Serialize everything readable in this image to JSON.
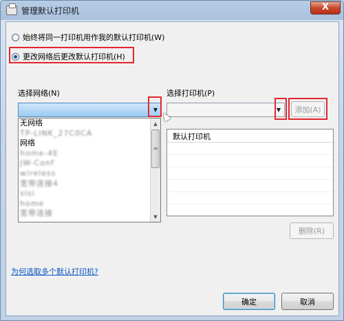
{
  "window": {
    "title": "管理默认打印机",
    "close_glyph": "X"
  },
  "options": {
    "always_same": "始终将同一打印机用作我的默认打印机(W)",
    "change_with_network": "更改网络后更改默认打印机(H)"
  },
  "network": {
    "label": "选择网络(N)",
    "items": [
      "无网络",
      "TP-LINK_27C0CA",
      "网络",
      "home-4E",
      "JW-Conf",
      "wireless",
      "宽带连接4",
      "sisi",
      "home",
      "宽带连接"
    ]
  },
  "printer": {
    "label": "选择打印机(P)",
    "add_label": "添加(A)"
  },
  "table": {
    "header": "默认打印机"
  },
  "buttons": {
    "remove": "删除(R)",
    "ok": "确定",
    "cancel": "取消"
  },
  "help_link": "为何选取多个默认打印机?",
  "icons": {
    "combo_arrow": "▼",
    "scroll_up": "▲",
    "scroll_down": "▼",
    "grip": "≡"
  },
  "colors": {
    "highlight_box": "#e2262b",
    "link": "#0a54c4",
    "selected_combo": "#9ccbf2"
  }
}
